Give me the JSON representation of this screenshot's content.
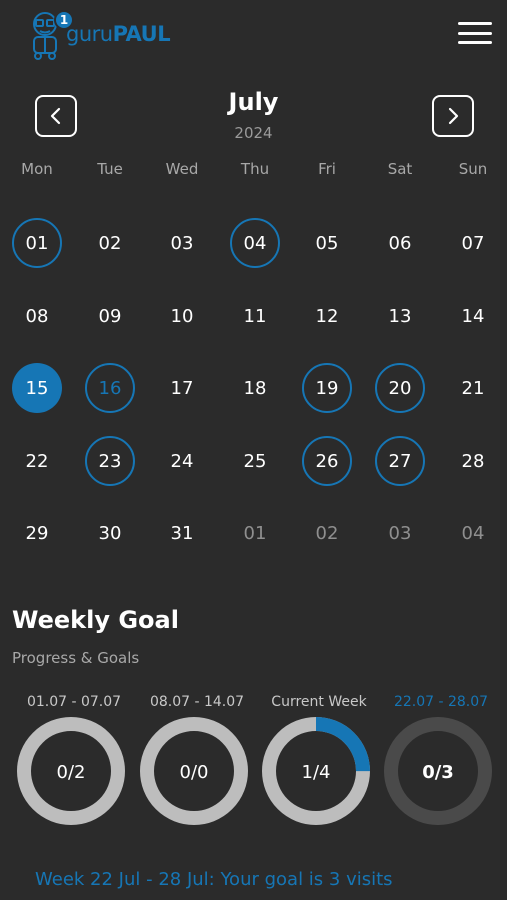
{
  "header": {
    "logo_text_a": "guru",
    "logo_text_b": "PAUL",
    "notification_count": "1"
  },
  "calendar": {
    "month": "July",
    "year": "2024",
    "weekdays": [
      "Mon",
      "Tue",
      "Wed",
      "Thu",
      "Fri",
      "Sat",
      "Sun"
    ],
    "weeks": [
      [
        {
          "d": "01",
          "s": "outline"
        },
        {
          "d": "02"
        },
        {
          "d": "03"
        },
        {
          "d": "04",
          "s": "outline"
        },
        {
          "d": "05"
        },
        {
          "d": "06"
        },
        {
          "d": "07"
        }
      ],
      [
        {
          "d": "08"
        },
        {
          "d": "09"
        },
        {
          "d": "10"
        },
        {
          "d": "11"
        },
        {
          "d": "12"
        },
        {
          "d": "13"
        },
        {
          "d": "14"
        }
      ],
      [
        {
          "d": "15",
          "s": "filled"
        },
        {
          "d": "16",
          "s": "outline-blue"
        },
        {
          "d": "17"
        },
        {
          "d": "18"
        },
        {
          "d": "19",
          "s": "outline"
        },
        {
          "d": "20",
          "s": "outline"
        },
        {
          "d": "21"
        }
      ],
      [
        {
          "d": "22"
        },
        {
          "d": "23",
          "s": "outline"
        },
        {
          "d": "24"
        },
        {
          "d": "25"
        },
        {
          "d": "26",
          "s": "outline"
        },
        {
          "d": "27",
          "s": "outline"
        },
        {
          "d": "28"
        }
      ],
      [
        {
          "d": "29"
        },
        {
          "d": "30"
        },
        {
          "d": "31"
        },
        {
          "d": "01",
          "s": "muted"
        },
        {
          "d": "02",
          "s": "muted"
        },
        {
          "d": "03",
          "s": "muted"
        },
        {
          "d": "04",
          "s": "muted"
        }
      ]
    ]
  },
  "weekly_goal": {
    "title": "Weekly Goal",
    "subtitle": "Progress & Goals",
    "weeks": [
      {
        "label": "01.07 - 07.07",
        "value": "0/2",
        "progress": 0,
        "active": false,
        "track": "#bdbdbd"
      },
      {
        "label": "08.07 - 14.07",
        "value": "0/0",
        "progress": 0,
        "active": false,
        "track": "#bdbdbd"
      },
      {
        "label": "Current Week",
        "value": "1/4",
        "progress": 0.25,
        "active": false,
        "track": "#bdbdbd"
      },
      {
        "label": "22.07 - 28.07",
        "value": "0/3",
        "progress": 0,
        "active": true,
        "track": "#4a4a4a"
      }
    ],
    "message": "Week 22 Jul - 28 Jul: Your goal is 3 visits"
  },
  "colors": {
    "accent": "#1676b5",
    "background": "#2b2b2b"
  }
}
